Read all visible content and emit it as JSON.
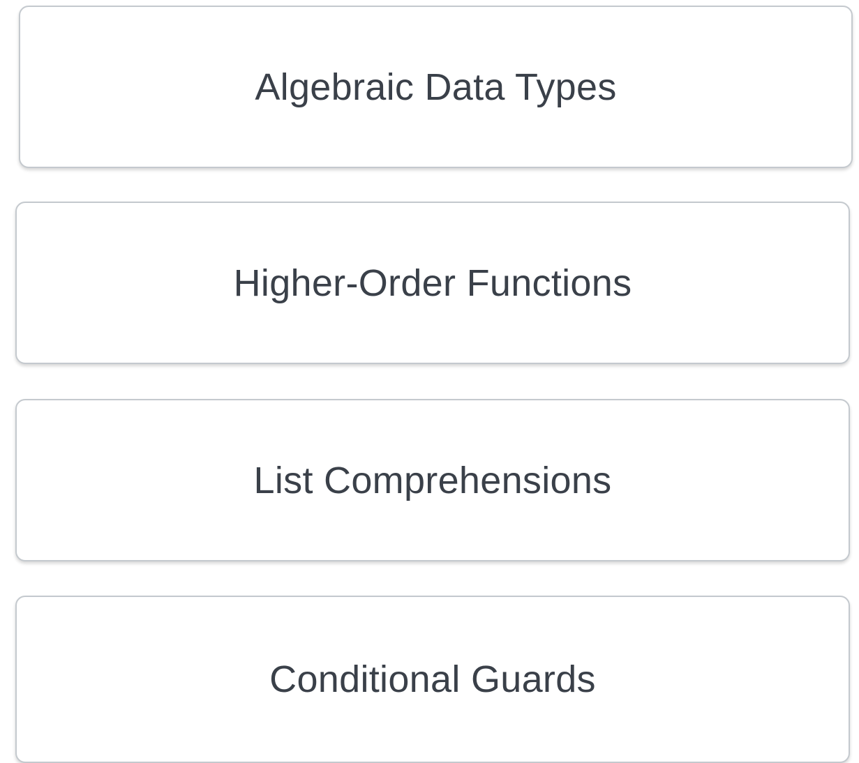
{
  "options": [
    {
      "label": "Algebraic Data Types"
    },
    {
      "label": "Higher-Order Functions"
    },
    {
      "label": "List Comprehensions"
    },
    {
      "label": "Conditional Guards"
    }
  ]
}
